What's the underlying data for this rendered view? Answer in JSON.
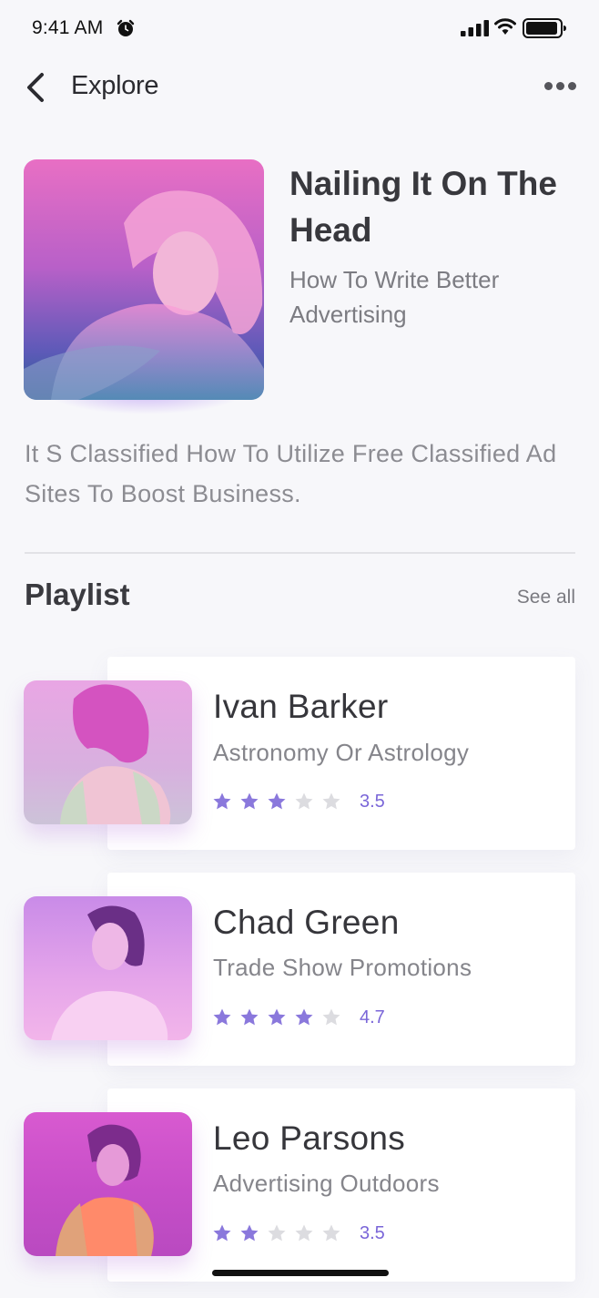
{
  "status_bar": {
    "time": "9:41 AM",
    "icons": [
      "alarm-icon",
      "signal-icon",
      "wifi-icon",
      "battery-icon"
    ]
  },
  "nav": {
    "title": "Explore",
    "back_icon": "chevron-left-icon",
    "more_icon": "more-horizontal-icon"
  },
  "featured": {
    "title": "Nailing It On The Head",
    "subtitle": "How To Write Better Advertising",
    "description": "It S Classified How To Utilize Free Classified Ad Sites To Boost Business."
  },
  "playlist": {
    "title": "Playlist",
    "see_all": "See all",
    "items": [
      {
        "name": "Ivan Barker",
        "topic": "Astronomy Or Astrology",
        "rating": 3.5,
        "rating_label": "3.5",
        "filled_stars": 3
      },
      {
        "name": "Chad Green",
        "topic": "Trade Show Promotions",
        "rating": 4.7,
        "rating_label": "4.7",
        "filled_stars": 4
      },
      {
        "name": "Leo Parsons",
        "topic": "Advertising Outdoors",
        "rating": 3.5,
        "rating_label": "3.5",
        "filled_stars": 2
      }
    ]
  },
  "colors": {
    "accent": "#7a66d8",
    "star_filled": "#8a78dc",
    "star_empty": "#dcdce0",
    "background": "#f7f7fa"
  }
}
